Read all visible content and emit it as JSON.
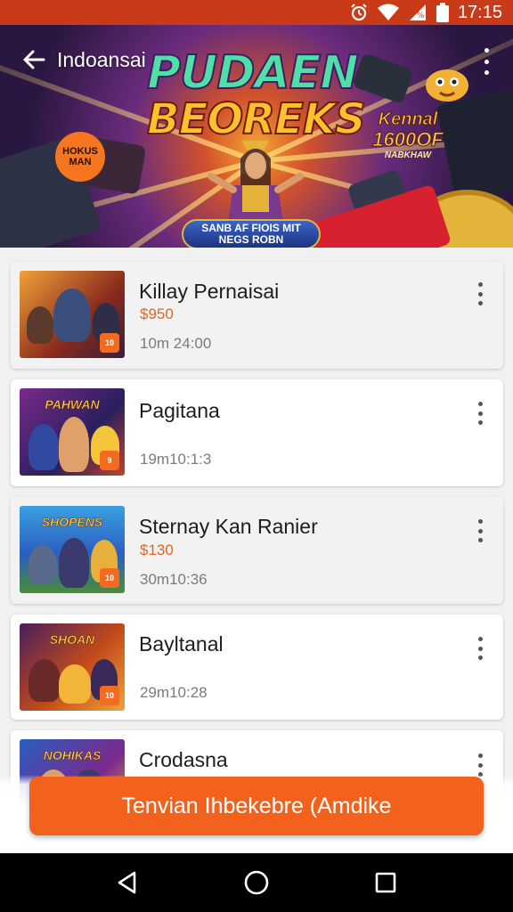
{
  "status_bar": {
    "time": "17:15",
    "icons": [
      "alarm-icon",
      "wifi-icon",
      "signal-icon",
      "battery-icon"
    ]
  },
  "header": {
    "title": "Indoansai",
    "back_icon": "arrow-left-icon",
    "menu_icon": "more-vertical-icon"
  },
  "hero": {
    "headline_line1": "PUDAEN",
    "headline_line2": "BEOREKS",
    "ribbon": "SANB AF FIOIS MIT NEGS ROBN",
    "badge": "HOKUS MAN",
    "promo_line1": "Kennal",
    "promo_line2": "1600OF",
    "promo_line3": "NABKHAW"
  },
  "items": [
    {
      "title": "Killay Pernaisai",
      "price": "$950",
      "meta": "10m 24:00",
      "thumb_label": "",
      "thumb_badge": "10",
      "shaded": true
    },
    {
      "title": "Pagitana",
      "price": "",
      "meta": "19m10:1:3",
      "thumb_label": "PAHWAN",
      "thumb_badge": "9",
      "shaded": false
    },
    {
      "title": "Sternay Kan Ranier",
      "price": "$130",
      "meta": "30m10:36",
      "thumb_label": "SHOPENS",
      "thumb_badge": "10",
      "shaded": true
    },
    {
      "title": "Bayltanal",
      "price": "",
      "meta": "29m10:28",
      "thumb_label": "SHOAN",
      "thumb_badge": "10",
      "shaded": false
    },
    {
      "title": "Crodasna",
      "price": "",
      "meta": "",
      "thumb_label": "NOHIKAS",
      "thumb_badge": "",
      "shaded": false
    }
  ],
  "item_menu_icon": "more-vertical-icon",
  "cta": {
    "label": "Tenvian Ihbekebre (Amdike"
  },
  "nav": [
    "back-triangle-icon",
    "home-circle-icon",
    "recents-square-icon"
  ],
  "colors": {
    "accent": "#f3621d",
    "status_bar": "#c83a18",
    "price": "#e2661d"
  }
}
